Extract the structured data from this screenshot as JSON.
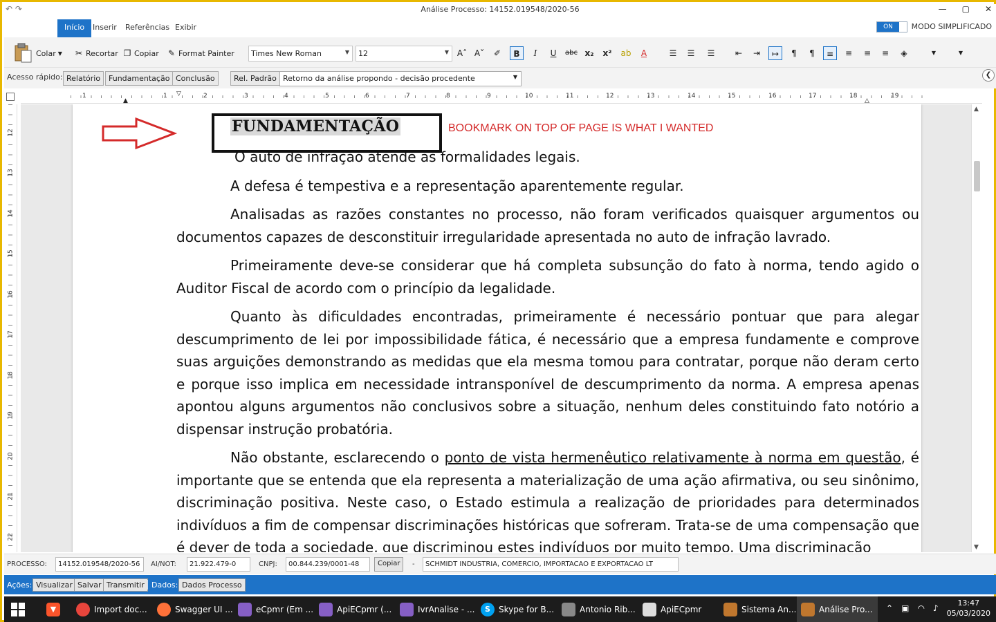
{
  "window": {
    "title": "Análise Processo: 14152.019548/2020-56",
    "controls": [
      "—",
      "▢",
      "✕"
    ]
  },
  "ribbon": {
    "tabs": [
      "Início",
      "Inserir",
      "Referências",
      "Exibir"
    ],
    "active_tab": "Início",
    "toggle_label": "ON",
    "mode_label": "MODO SIMPLIFICADO"
  },
  "toolbar": {
    "paste": "Colar",
    "cut": "Recortar",
    "copy": "Copiar",
    "format_painter": "Format Painter",
    "font_family": "Times New Roman",
    "font_size": "12"
  },
  "quick_access": {
    "label": "Acesso rápido:",
    "buttons": [
      "Relatório",
      "Fundamentação",
      "Conclusão"
    ],
    "rel_padrao": "Rel. Padrão",
    "template_value": "Retorno da análise propondo - decisão procedente"
  },
  "ruler": {
    "h_numbers": [
      "1",
      "1",
      "2",
      "3",
      "4",
      "5",
      "6",
      "7",
      "8",
      "9",
      "10",
      "11",
      "12",
      "13",
      "14",
      "15",
      "16",
      "17",
      "18",
      "19"
    ],
    "v_numbers": [
      "12",
      "13",
      "14",
      "15",
      "16",
      "17",
      "18",
      "19",
      "20",
      "21",
      "22"
    ]
  },
  "document": {
    "heading": "FUNDAMENTAÇÃO",
    "annotation": "BOOKMARK ON TOP OF PAGE IS WHAT I WANTED",
    "p1": "O auto de infração atende as formalidades legais.",
    "p2": "A defesa é tempestiva e a representação aparentemente regular.",
    "p3": "Analisadas as razões constantes no processo, não foram verificados quaisquer argumentos ou documentos capazes de desconstituir irregularidade apresentada no auto de infração lavrado.",
    "p4": "Primeiramente deve-se considerar que há completa subsunção do fato à norma, tendo agido o Auditor Fiscal de acordo com o princípio da legalidade.",
    "p5": "Quanto às dificuldades encontradas, primeiramente é necessário pontuar que para alegar descumprimento de lei por impossibilidade fática, é necessário que a empresa fundamente e comprove suas arguições demonstrando as medidas que ela mesma tomou para contratar, porque não deram certo e porque isso implica em necessidade intransponível de descumprimento da norma. A empresa apenas apontou alguns argumentos não conclusivos sobre a situação, nenhum deles constituindo fato notório a dispensar instrução probatória.",
    "p6_start": "Não obstante, esclarecendo o ",
    "p6_underlined": "ponto de vista hermenêutico relativamente à norma em questão",
    "p6_end": ", é importante que se entenda que ela representa a materialização de uma ação afirmativa, ou seu sinônimo, discriminação positiva. Neste caso, o Estado estimula a realização de prioridades para determinados indivíduos a fim de compensar discriminações históricas que sofreram. Trata-se de uma compensação que é dever de toda a sociedade, que discriminou estes indivíduos por muito tempo. Uma discriminação"
  },
  "status": {
    "processo_label": "PROCESSO:",
    "processo_value": "14152.019548/2020-56",
    "ainot_label": "AI/NOT:",
    "ainot_value": "21.922.479-0",
    "cnpj_label": "CNPJ:",
    "cnpj_value": "00.844.239/0001-48",
    "copy_button": "Copiar",
    "dash": "-",
    "company": "SCHMIDT INDUSTRIA, COMERCIO, IMPORTACAO E EXPORTACAO LT"
  },
  "actions": {
    "label": "Ações:",
    "buttons": [
      "Visualizar",
      "Salvar",
      "Transmitir"
    ],
    "dados_label": "Dados:",
    "dados_button": "Dados Processo"
  },
  "taskbar": {
    "items": [
      {
        "label": "Import doc...",
        "icon": "chrome-icon",
        "color": "#e8453c"
      },
      {
        "label": "Swagger UI ...",
        "icon": "firefox-icon",
        "color": "#ff7139"
      },
      {
        "label": "eCpmr (Em ...",
        "icon": "visual-studio-icon",
        "color": "#865fc5"
      },
      {
        "label": "ApiECpmr (...",
        "icon": "visual-studio-icon",
        "color": "#865fc5"
      },
      {
        "label": "IvrAnalise - ...",
        "icon": "visual-studio-icon",
        "color": "#865fc5"
      },
      {
        "label": "Skype for B...",
        "icon": "skype-icon",
        "color": "#00a1f1"
      },
      {
        "label": "Antonio Rib...",
        "icon": "chat-icon",
        "color": "#888888"
      },
      {
        "label": "ApiECpmr",
        "icon": "window-icon",
        "color": "#dddddd"
      },
      {
        "label": "Sistema An...",
        "icon": "app-icon",
        "color": "#c0772e"
      },
      {
        "label": "Análise Pro...",
        "icon": "app-icon",
        "color": "#c0772e"
      }
    ],
    "time": "13:47",
    "date": "05/03/2020"
  }
}
